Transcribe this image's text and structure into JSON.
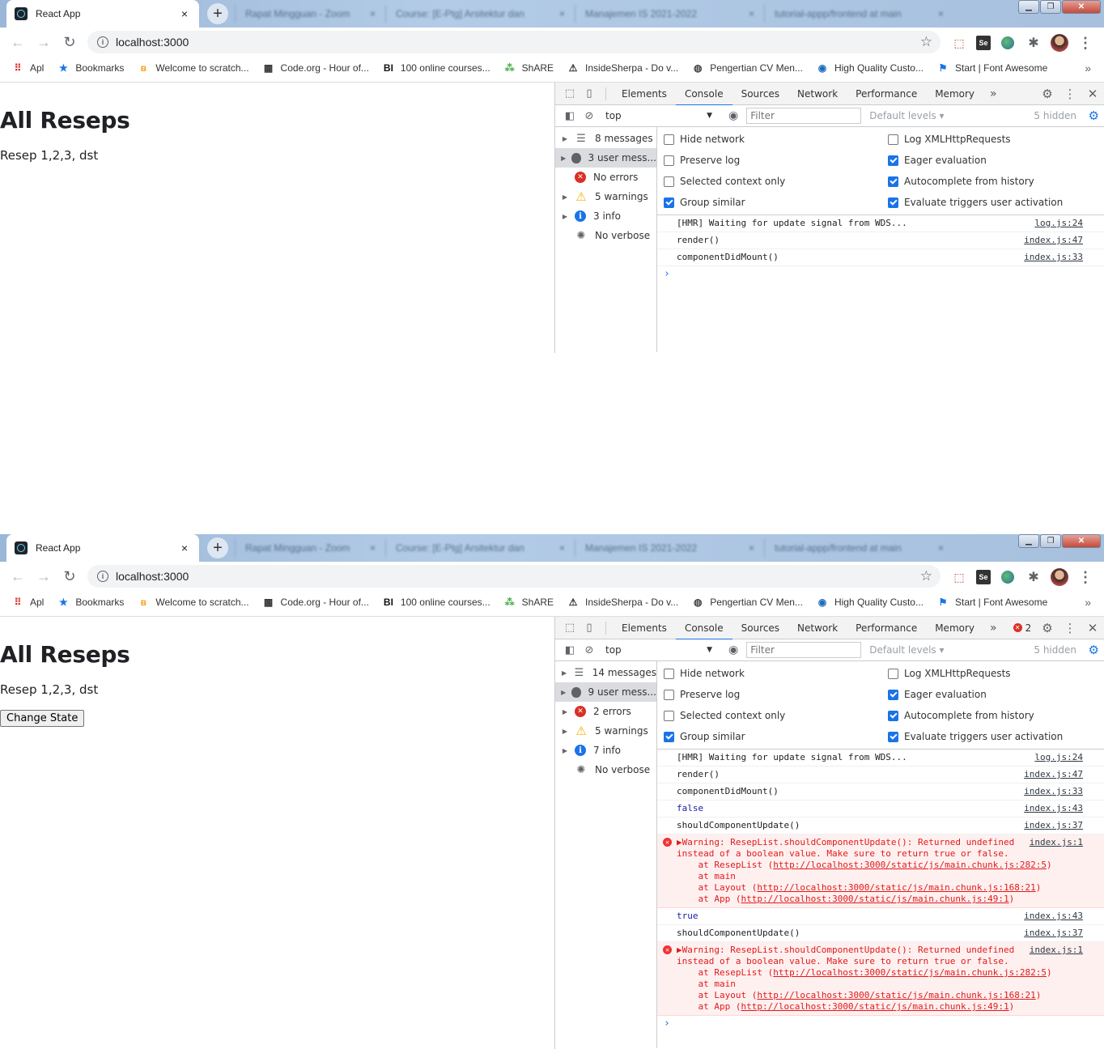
{
  "panels": [
    {
      "browser": {
        "tab_title": "React App",
        "tab_close": "×",
        "new_tab": "+",
        "background_tabs": [
          {
            "label": "Rapat Mingguan - Zoom",
            "close": "×"
          },
          {
            "label": "Course: [E-Ptg] Arsitektur dan",
            "close": "×"
          },
          {
            "label": "Manajemen IS 2021-2022",
            "close": "×"
          },
          {
            "label": "tutorial-appp/frontend at main",
            "close": "×"
          }
        ],
        "window_controls": {
          "minimize": "▁",
          "maximize": "❐",
          "close": "✕"
        },
        "nav": {
          "back": "←",
          "forward": "→",
          "reload": "↻"
        },
        "info_glyph": "i",
        "url": "localhost:3000",
        "star": "☆",
        "ext_pdf": "⬚",
        "ext_se": "Se",
        "ext_puzzle": "✱",
        "ext_menu": "⋮"
      },
      "bookmarks": [
        {
          "label": "Apl",
          "icon": "apps-grid-icon",
          "glyph": "⠿",
          "color": "#d93025"
        },
        {
          "label": "Bookmarks",
          "icon": "star-icon",
          "glyph": "★",
          "color": "#1a73e8"
        },
        {
          "label": "Welcome to scratch...",
          "icon": "scratch-icon",
          "glyph": "ʙ",
          "color": "#f4a21d"
        },
        {
          "label": "Code.org - Hour of...",
          "icon": "code-org-icon",
          "glyph": "▦",
          "color": "#333333"
        },
        {
          "label": "100 online courses...",
          "icon": "bi-icon",
          "glyph": "BI",
          "color": "#111111"
        },
        {
          "label": "ShARE",
          "icon": "share-icon",
          "glyph": "⁂",
          "color": "#4caf50"
        },
        {
          "label": "InsideSherpa - Do v...",
          "icon": "sherpa-icon",
          "glyph": "⚠",
          "color": "#333333"
        },
        {
          "label": "Pengertian CV Men...",
          "icon": "globe-icon",
          "glyph": "◍",
          "color": "#444444"
        },
        {
          "label": "High Quality Custo...",
          "icon": "fiverr-icon",
          "glyph": "◉",
          "color": "#1d6fb8"
        },
        {
          "label": "Start | Font Awesome",
          "icon": "flag-icon",
          "glyph": "⚑",
          "color": "#1a73e8"
        }
      ],
      "bookmarks_more": "»",
      "page": {
        "heading": "All Reseps",
        "text": "Resep 1,2,3, dst",
        "button": ""
      },
      "devtools": {
        "tabs": [
          "Elements",
          "Console",
          "Sources",
          "Network",
          "Performance",
          "Memory"
        ],
        "more": "»",
        "error_count": "",
        "context": "top",
        "filter_placeholder": "Filter",
        "default_levels": "Default levels ▾",
        "hidden": "5 hidden",
        "sidebar": [
          {
            "label": "8 messages",
            "icon": "list-icon",
            "arrow": "▶"
          },
          {
            "label": "3 user mess...",
            "icon": "user-icon",
            "arrow": "▶"
          },
          {
            "label": "No errors",
            "icon": "error-icon",
            "arrow": ""
          },
          {
            "label": "5 warnings",
            "icon": "warning-icon",
            "arrow": "▶"
          },
          {
            "label": "3 info",
            "icon": "info-icon",
            "arrow": "▶"
          },
          {
            "label": "No verbose",
            "icon": "bug-icon",
            "arrow": ""
          }
        ],
        "settings": [
          {
            "label": "Hide network",
            "checked": false
          },
          {
            "label": "Log XMLHttpRequests",
            "checked": false
          },
          {
            "label": "Preserve log",
            "checked": false
          },
          {
            "label": "Eager evaluation",
            "checked": true
          },
          {
            "label": "Selected context only",
            "checked": false
          },
          {
            "label": "Autocomplete from history",
            "checked": true
          },
          {
            "label": "Group similar",
            "checked": true
          },
          {
            "label": "Evaluate triggers user activation",
            "checked": true
          }
        ],
        "logs": [
          {
            "type": "log",
            "text": "[HMR] Waiting for update signal from WDS...",
            "source": "log.js:24"
          },
          {
            "type": "log",
            "text": "render()",
            "source": "index.js:47"
          },
          {
            "type": "log",
            "text": "componentDidMount()",
            "source": "index.js:33"
          }
        ],
        "prompt": "›"
      }
    },
    {
      "browser": {
        "tab_title": "React App",
        "tab_close": "×",
        "new_tab": "+",
        "background_tabs": [
          {
            "label": "Rapat Mingguan - Zoom",
            "close": "×"
          },
          {
            "label": "Course: [E-Ptg] Arsitektur dan",
            "close": "×"
          },
          {
            "label": "Manajemen IS 2021-2022",
            "close": "×"
          },
          {
            "label": "tutorial-appp/frontend at main",
            "close": "×"
          }
        ],
        "window_controls": {
          "minimize": "▁",
          "maximize": "❐",
          "close": "✕"
        },
        "nav": {
          "back": "←",
          "forward": "→",
          "reload": "↻"
        },
        "info_glyph": "i",
        "url": "localhost:3000",
        "star": "☆",
        "ext_pdf": "⬚",
        "ext_se": "Se",
        "ext_puzzle": "✱",
        "ext_menu": "⋮"
      },
      "bookmarks": [
        {
          "label": "Apl",
          "icon": "apps-grid-icon",
          "glyph": "⠿",
          "color": "#d93025"
        },
        {
          "label": "Bookmarks",
          "icon": "star-icon",
          "glyph": "★",
          "color": "#1a73e8"
        },
        {
          "label": "Welcome to scratch...",
          "icon": "scratch-icon",
          "glyph": "ʙ",
          "color": "#f4a21d"
        },
        {
          "label": "Code.org - Hour of...",
          "icon": "code-org-icon",
          "glyph": "▦",
          "color": "#333333"
        },
        {
          "label": "100 online courses...",
          "icon": "bi-icon",
          "glyph": "BI",
          "color": "#111111"
        },
        {
          "label": "ShARE",
          "icon": "share-icon",
          "glyph": "⁂",
          "color": "#4caf50"
        },
        {
          "label": "InsideSherpa - Do v...",
          "icon": "sherpa-icon",
          "glyph": "⚠",
          "color": "#333333"
        },
        {
          "label": "Pengertian CV Men...",
          "icon": "globe-icon",
          "glyph": "◍",
          "color": "#444444"
        },
        {
          "label": "High Quality Custo...",
          "icon": "fiverr-icon",
          "glyph": "◉",
          "color": "#1d6fb8"
        },
        {
          "label": "Start | Font Awesome",
          "icon": "flag-icon",
          "glyph": "⚑",
          "color": "#1a73e8"
        }
      ],
      "bookmarks_more": "»",
      "page": {
        "heading": "All Reseps",
        "text": "Resep 1,2,3, dst",
        "button": "Change State"
      },
      "devtools": {
        "tabs": [
          "Elements",
          "Console",
          "Sources",
          "Network",
          "Performance",
          "Memory"
        ],
        "more": "»",
        "error_count": "2",
        "context": "top",
        "filter_placeholder": "Filter",
        "default_levels": "Default levels ▾",
        "hidden": "5 hidden",
        "sidebar": [
          {
            "label": "14 messages",
            "icon": "list-icon",
            "arrow": "▶"
          },
          {
            "label": "9 user mess...",
            "icon": "user-icon",
            "arrow": "▶"
          },
          {
            "label": "2 errors",
            "icon": "error-icon",
            "arrow": "▶"
          },
          {
            "label": "5 warnings",
            "icon": "warning-icon",
            "arrow": "▶"
          },
          {
            "label": "7 info",
            "icon": "info-icon",
            "arrow": "▶"
          },
          {
            "label": "No verbose",
            "icon": "bug-icon",
            "arrow": ""
          }
        ],
        "settings": [
          {
            "label": "Hide network",
            "checked": false
          },
          {
            "label": "Log XMLHttpRequests",
            "checked": false
          },
          {
            "label": "Preserve log",
            "checked": false
          },
          {
            "label": "Eager evaluation",
            "checked": true
          },
          {
            "label": "Selected context only",
            "checked": false
          },
          {
            "label": "Autocomplete from history",
            "checked": true
          },
          {
            "label": "Group similar",
            "checked": true
          },
          {
            "label": "Evaluate triggers user activation",
            "checked": true
          }
        ],
        "logs": [
          {
            "type": "log",
            "text": "[HMR] Waiting for update signal from WDS...",
            "source": "log.js:24"
          },
          {
            "type": "log",
            "text": "render()",
            "source": "index.js:47"
          },
          {
            "type": "log",
            "text": "componentDidMount()",
            "source": "index.js:33"
          },
          {
            "type": "bool",
            "text": "false",
            "source": "index.js:43"
          },
          {
            "type": "log",
            "text": "shouldComponentUpdate()",
            "source": "index.js:37"
          },
          {
            "type": "error",
            "text": "▶Warning: ResepList.shouldComponentUpdate(): Returned undefined\ninstead of a boolean value. Make sure to return true or false.",
            "source": "index.js:1",
            "stack": [
              {
                "prefix": "    at ResepList (",
                "link": "http://localhost:3000/static/js/main.chunk.js:282:5",
                "suffix": ")"
              },
              {
                "prefix": "    at main",
                "link": "",
                "suffix": ""
              },
              {
                "prefix": "    at Layout (",
                "link": "http://localhost:3000/static/js/main.chunk.js:168:21",
                "suffix": ")"
              },
              {
                "prefix": "    at App (",
                "link": "http://localhost:3000/static/js/main.chunk.js:49:1",
                "suffix": ")"
              }
            ]
          },
          {
            "type": "bool",
            "text": "true",
            "source": "index.js:43"
          },
          {
            "type": "log",
            "text": "shouldComponentUpdate()",
            "source": "index.js:37"
          },
          {
            "type": "error",
            "text": "▶Warning: ResepList.shouldComponentUpdate(): Returned undefined\ninstead of a boolean value. Make sure to return true or false.",
            "source": "index.js:1",
            "stack": [
              {
                "prefix": "    at ResepList (",
                "link": "http://localhost:3000/static/js/main.chunk.js:282:5",
                "suffix": ")"
              },
              {
                "prefix": "    at main",
                "link": "",
                "suffix": ""
              },
              {
                "prefix": "    at Layout (",
                "link": "http://localhost:3000/static/js/main.chunk.js:168:21",
                "suffix": ")"
              },
              {
                "prefix": "    at App (",
                "link": "http://localhost:3000/static/js/main.chunk.js:49:1",
                "suffix": ")"
              }
            ]
          }
        ],
        "prompt": "›"
      }
    }
  ]
}
